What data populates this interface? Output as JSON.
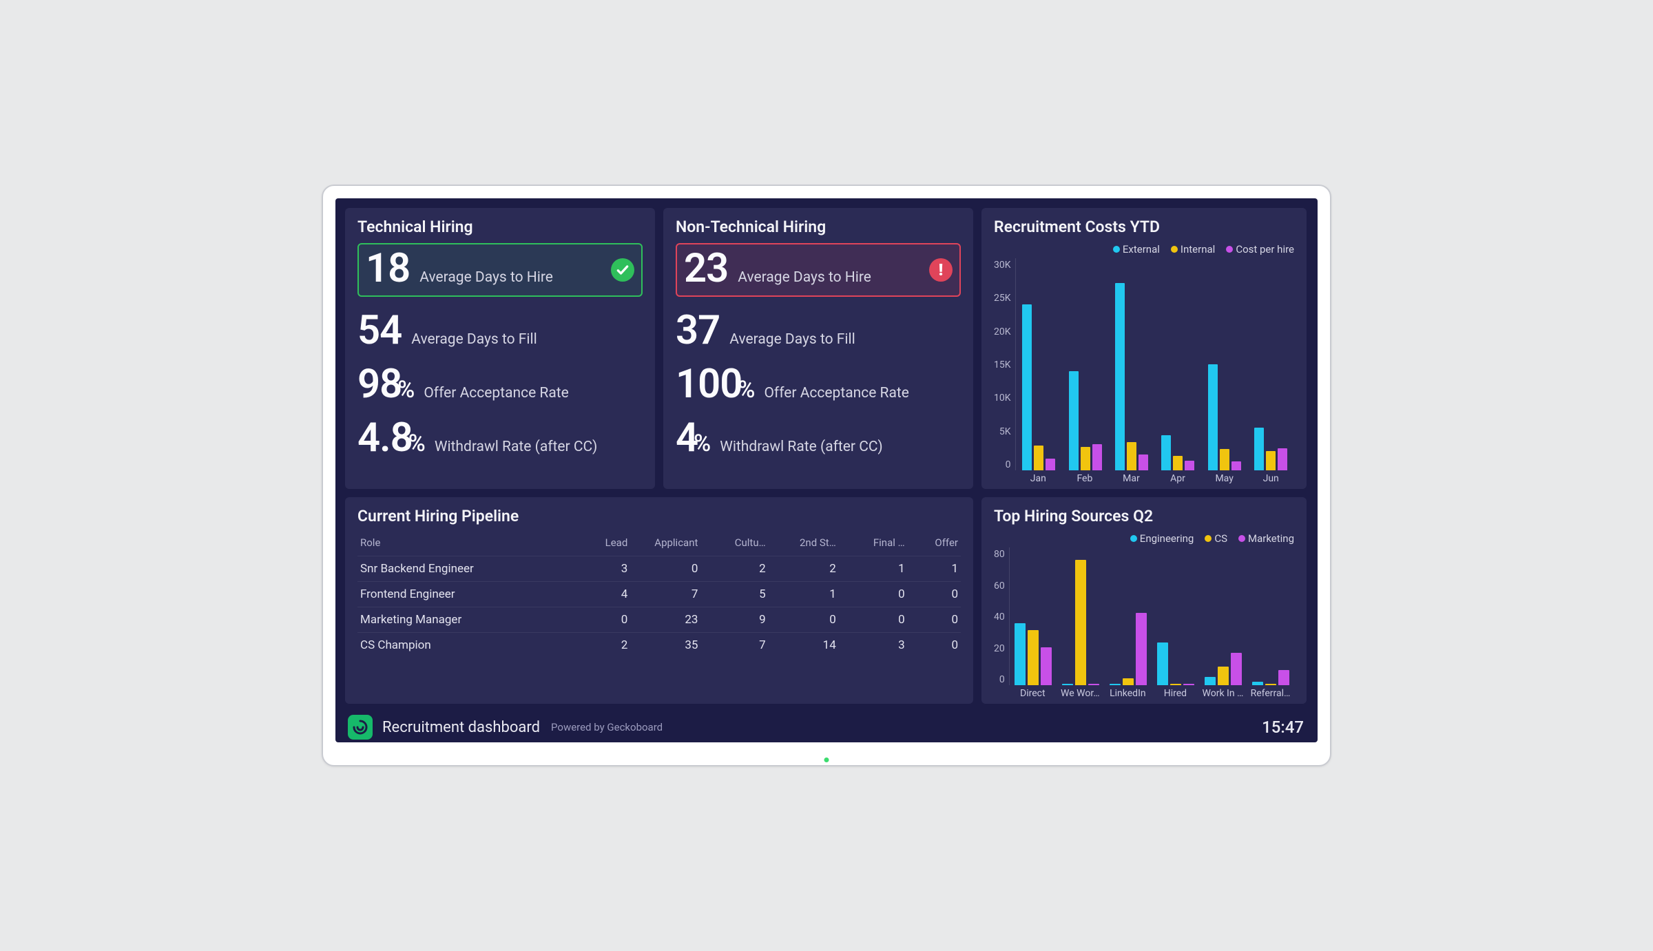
{
  "colors": {
    "cyan": "#21c8f0",
    "yellow": "#f1c40f",
    "magenta": "#c850e8"
  },
  "tech": {
    "title": "Technical Hiring",
    "days_to_hire": {
      "value": "18",
      "label": "Average Days to Hire",
      "status": "good"
    },
    "days_to_fill": {
      "value": "54",
      "label": "Average Days to Fill"
    },
    "offer_accept": {
      "value": "98",
      "unit": "%",
      "label": "Offer Acceptance Rate"
    },
    "withdrawl": {
      "value": "4.8",
      "unit": "%",
      "label": "Withdrawl Rate (after CC)"
    }
  },
  "nontech": {
    "title": "Non-Technical Hiring",
    "days_to_hire": {
      "value": "23",
      "label": "Average Days to Hire",
      "status": "bad"
    },
    "days_to_fill": {
      "value": "37",
      "label": "Average Days to Fill"
    },
    "offer_accept": {
      "value": "100",
      "unit": "%",
      "label": "Offer Acceptance Rate"
    },
    "withdrawl": {
      "value": "4",
      "unit": "%",
      "label": "Withdrawl Rate (after CC)"
    }
  },
  "costs": {
    "title": "Recruitment Costs YTD",
    "legend": [
      "External",
      "Internal",
      "Cost per hire"
    ]
  },
  "pipeline": {
    "title": "Current Hiring Pipeline",
    "headers": [
      "Role",
      "Lead",
      "Applicant",
      "Cultu…",
      "2nd St…",
      "Final …",
      "Offer"
    ],
    "rows": [
      {
        "role": "Snr Backend Engineer",
        "cells": [
          "3",
          "0",
          "2",
          "2",
          "1",
          "1"
        ]
      },
      {
        "role": "Frontend Engineer",
        "cells": [
          "4",
          "7",
          "5",
          "1",
          "0",
          "0"
        ]
      },
      {
        "role": "Marketing Manager",
        "cells": [
          "0",
          "23",
          "9",
          "0",
          "0",
          "0"
        ]
      },
      {
        "role": "CS Champion",
        "cells": [
          "2",
          "35",
          "7",
          "14",
          "3",
          "0"
        ]
      }
    ]
  },
  "sources": {
    "title": "Top Hiring Sources Q2",
    "legend": [
      "Engineering",
      "CS",
      "Marketing"
    ]
  },
  "footer": {
    "title": "Recruitment dashboard",
    "powered": "Powered by Geckoboard",
    "clock": "15:47"
  },
  "chart_data": [
    {
      "id": "recruitment_costs_ytd",
      "type": "bar",
      "title": "Recruitment Costs YTD",
      "categories": [
        "Jan",
        "Feb",
        "Mar",
        "Apr",
        "May",
        "Jun"
      ],
      "series": [
        {
          "name": "External",
          "color": "#21c8f0",
          "values": [
            23500,
            14000,
            26500,
            5000,
            15000,
            6000
          ]
        },
        {
          "name": "Internal",
          "color": "#f1c40f",
          "values": [
            3500,
            3300,
            4000,
            2000,
            3000,
            2700
          ]
        },
        {
          "name": "Cost per hire",
          "color": "#c850e8",
          "values": [
            1700,
            3700,
            2200,
            1400,
            1300,
            3100
          ]
        }
      ],
      "ylim": [
        0,
        30000
      ],
      "yticks": [
        0,
        5000,
        10000,
        15000,
        20000,
        25000,
        30000
      ],
      "ytick_labels": [
        "0",
        "5K",
        "10K",
        "15K",
        "20K",
        "25K",
        "30K"
      ]
    },
    {
      "id": "top_hiring_sources_q2",
      "type": "bar",
      "title": "Top Hiring Sources Q2",
      "categories": [
        "Direct",
        "We Wor…",
        "LinkedIn",
        "Hired",
        "Work In …",
        "Referral…"
      ],
      "series": [
        {
          "name": "Engineering",
          "color": "#21c8f0",
          "values": [
            36,
            0,
            1,
            25,
            5,
            2
          ]
        },
        {
          "name": "CS",
          "color": "#f1c40f",
          "values": [
            32,
            73,
            4,
            0,
            11,
            1
          ]
        },
        {
          "name": "Marketing",
          "color": "#c850e8",
          "values": [
            22,
            0,
            42,
            0,
            19,
            9
          ]
        }
      ],
      "ylim": [
        0,
        80
      ],
      "yticks": [
        0,
        20,
        40,
        60,
        80
      ],
      "ytick_labels": [
        "0",
        "20",
        "40",
        "60",
        "80"
      ]
    }
  ]
}
